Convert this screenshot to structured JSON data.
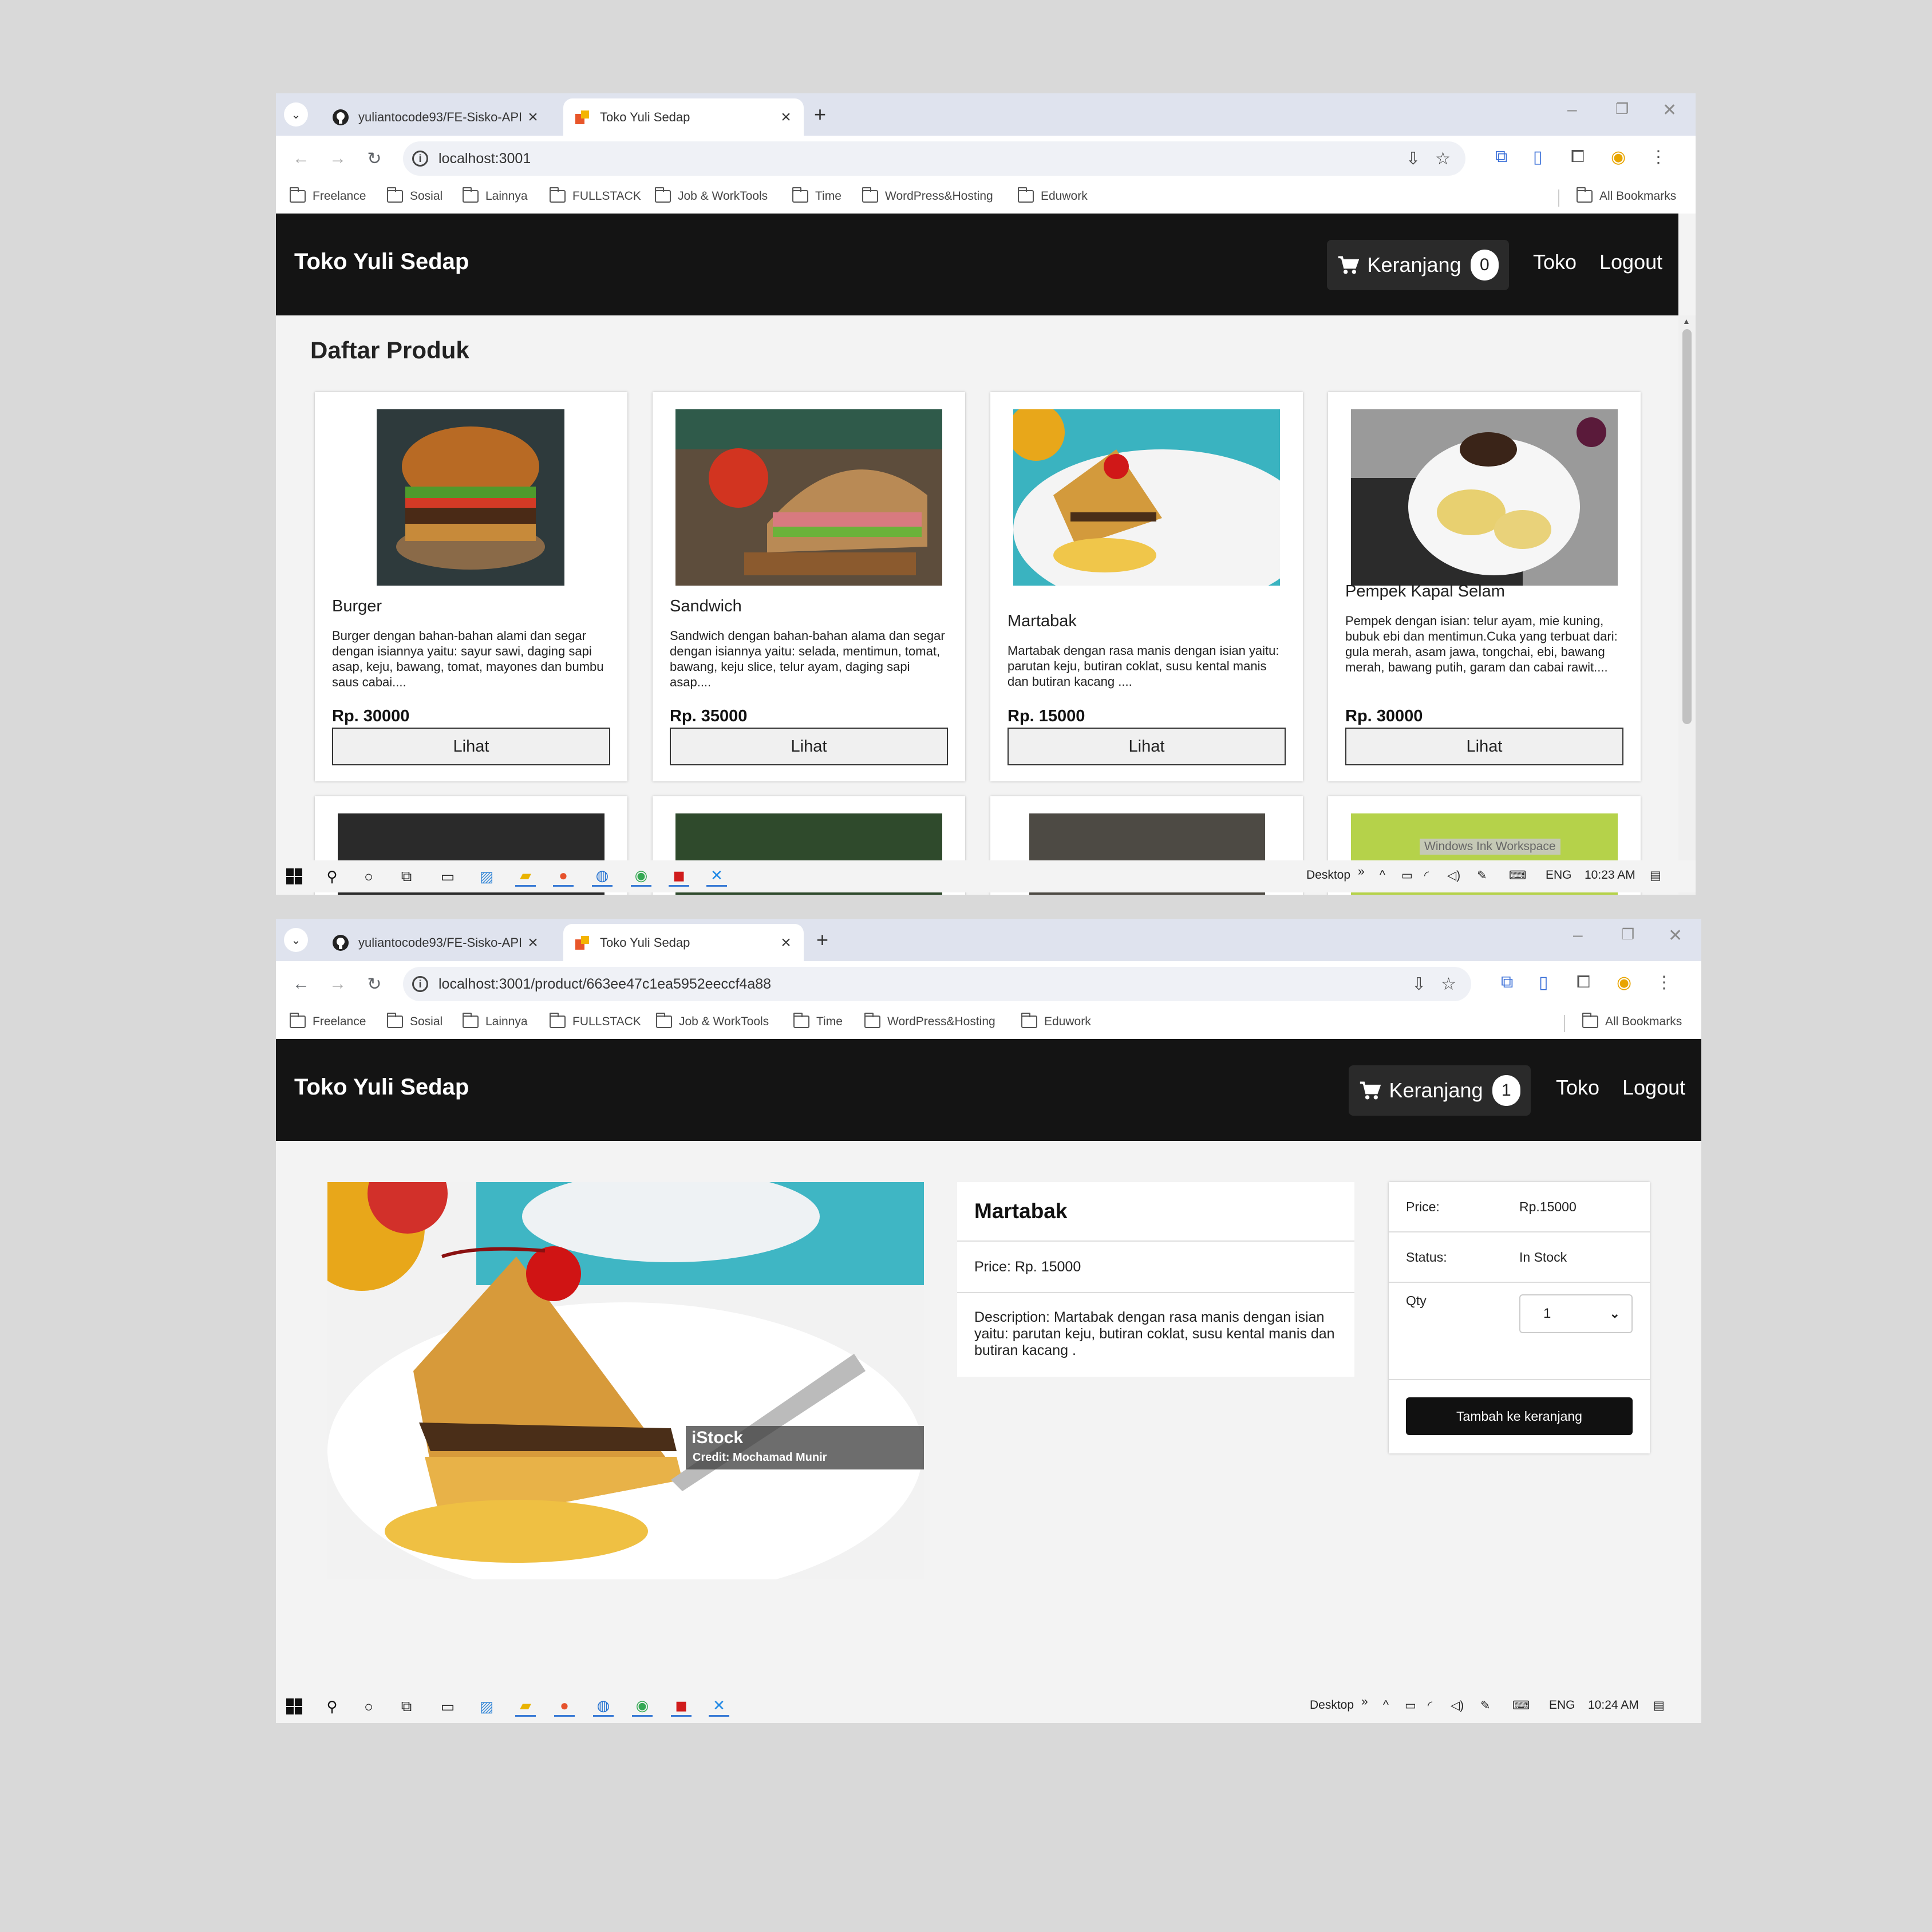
{
  "browser": {
    "tabs": [
      {
        "title": "yuliantocode93/FE-Sisko-API",
        "favicon": "github-icon"
      },
      {
        "title": "Toko Yuli Sedap",
        "favicon": "site-favicon-icon"
      }
    ],
    "bookmarks": [
      "Freelance",
      "Sosial",
      "Lainnya",
      "FULLSTACK",
      "Job & WorkTools",
      "Time",
      "WordPress&Hosting",
      "Eduwork"
    ],
    "all_bookmarks": "All Bookmarks"
  },
  "shot1": {
    "url": "localhost:3001",
    "brand": "Toko Yuli Sedap",
    "cart_label": "Keranjang",
    "cart_count": "0",
    "nav_toko": "Toko",
    "nav_logout": "Logout",
    "page_title": "Daftar Produk",
    "products": [
      {
        "name": "Burger",
        "description": "Burger dengan bahan-bahan alami dan segar dengan isiannya yaitu: sayur sawi, daging sapi asap, keju, bawang, tomat, mayones dan bumbu saus cabai....",
        "price": "Rp. 30000",
        "button": "Lihat"
      },
      {
        "name": "Sandwich",
        "description": "Sandwich dengan bahan-bahan alama dan segar dengan isiannya yaitu: selada, mentimun, tomat, bawang, keju slice, telur ayam, daging sapi asap....",
        "price": "Rp. 35000",
        "button": "Lihat"
      },
      {
        "name": "Martabak",
        "description": "Martabak dengan rasa manis dengan isian yaitu: parutan keju, butiran coklat, susu kental manis dan butiran kacang ....",
        "price": "Rp. 15000",
        "button": "Lihat"
      },
      {
        "name": "Pempek Kapal Selam",
        "description": "Pempek dengan isian: telur ayam, mie kuning, bubuk ebi dan mentimun.Cuka yang terbuat dari: gula merah, asam jawa, tongchai, ebi, bawang merah, bawang putih, garam dan cabai rawit....",
        "price": "Rp. 30000",
        "button": "Lihat"
      }
    ],
    "ink_workspace": "Windows Ink Workspace",
    "taskbar": {
      "desktop": "Desktop",
      "lang": "ENG",
      "time": "10:23 AM"
    }
  },
  "shot2": {
    "url": "localhost:3001/product/663ee47c1ea5952eeccf4a88",
    "brand": "Toko Yuli Sedap",
    "cart_label": "Keranjang",
    "cart_count": "1",
    "nav_toko": "Toko",
    "nav_logout": "Logout",
    "product": {
      "name": "Martabak",
      "price_line": "Price: Rp. 15000",
      "description_line": "Description: Martabak dengan rasa manis dengan isian yaitu: parutan keju, butiran coklat, susu kental manis dan butiran kacang .",
      "watermark_brand": "iStock",
      "watermark_credit": "Credit: Mochamad Munir"
    },
    "buy": {
      "price_label": "Price:",
      "price_value": "Rp.15000",
      "status_label": "Status:",
      "status_value": "In Stock",
      "qty_label": "Qty",
      "qty_value": "1",
      "add_button": "Tambah ke keranjang"
    },
    "taskbar": {
      "desktop": "Desktop",
      "lang": "ENG",
      "time": "10:24 AM"
    }
  }
}
